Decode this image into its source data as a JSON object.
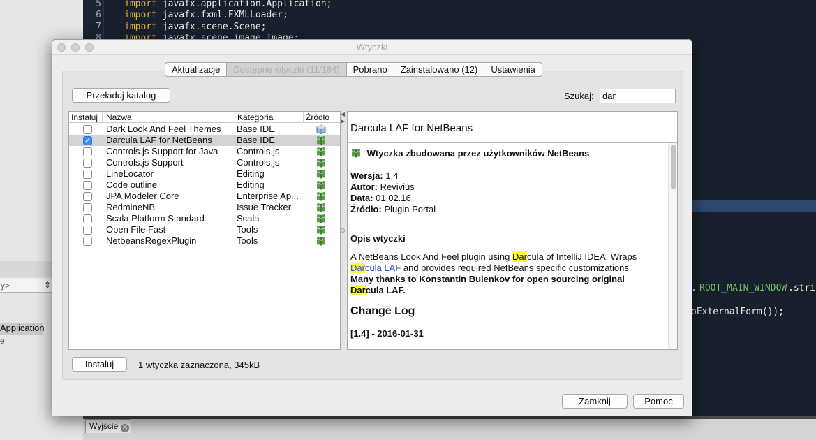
{
  "ide": {
    "code_lines": [
      {
        "num": "5",
        "keyword": "import",
        "text": " javafx.application.Application;"
      },
      {
        "num": "6",
        "keyword": "import",
        "text": " javafx.fxml.FXMLLoader;"
      },
      {
        "num": "7",
        "keyword": "import",
        "text": " javafx.scene.Scene;"
      },
      {
        "num": "8",
        "keyword": "import",
        "text": " javafx.scene.image.Image;"
      }
    ],
    "fragment_1_green": "ROOT_MAIN_WINDOW",
    "fragment_1_prefix": ".",
    "fragment_1_suffix": ".stri",
    "fragment_2": "oExternalForm());",
    "left_combo": "y>",
    "left_selected": "Application",
    "left_sub": "e",
    "output_tab": "Wyjście"
  },
  "dialog": {
    "title": "Wtyczki",
    "tabs": [
      {
        "label": "Aktualizacje"
      },
      {
        "label": "Dostępne wtyczki (11/184)"
      },
      {
        "label": "Pobrano"
      },
      {
        "label": "Zainstalowano (12)"
      },
      {
        "label": "Ustawienia"
      }
    ],
    "reload_button": "Przeładuj katalog",
    "search_label": "Szukaj:",
    "search_value": "dar",
    "table": {
      "headers": [
        "Instaluj",
        "Nazwa",
        "Kategoria",
        "Źródło"
      ],
      "rows": [
        {
          "checked": false,
          "name": "Dark Look And Feel Themes",
          "category": "Base IDE",
          "source_icon": "cube-icon"
        },
        {
          "checked": true,
          "name": "Darcula LAF for NetBeans",
          "category": "Base IDE",
          "source_icon": "community-icon"
        },
        {
          "checked": false,
          "name": "Controls.js Support for Java",
          "category": "Controls.js",
          "source_icon": "community-icon"
        },
        {
          "checked": false,
          "name": "Controls.js Support",
          "category": "Controls.js",
          "source_icon": "community-icon"
        },
        {
          "checked": false,
          "name": "LineLocator",
          "category": "Editing",
          "source_icon": "community-icon"
        },
        {
          "checked": false,
          "name": "Code outline",
          "category": "Editing",
          "source_icon": "community-icon"
        },
        {
          "checked": false,
          "name": "JPA Modeler Core",
          "category": "Enterprise Ap...",
          "source_icon": "community-icon"
        },
        {
          "checked": false,
          "name": "RedmineNB",
          "category": "Issue Tracker",
          "source_icon": "community-icon"
        },
        {
          "checked": false,
          "name": "Scala Platform Standard",
          "category": "Scala",
          "source_icon": "community-icon"
        },
        {
          "checked": false,
          "name": "Open File Fast",
          "category": "Tools",
          "source_icon": "community-icon"
        },
        {
          "checked": false,
          "name": "NetbeansRegexPlugin",
          "category": "Tools",
          "source_icon": "community-icon"
        }
      ]
    },
    "details": {
      "title": "Darcula LAF for NetBeans",
      "community_text": "Wtyczka zbudowana przez użytkowników NetBeans",
      "version_label": "Wersja:",
      "version": "1.4",
      "author_label": "Autor:",
      "author": "Revivius",
      "date_label": "Data:",
      "date": "01.02.16",
      "source_label": "Źródło:",
      "source": "Plugin Portal",
      "desc_heading": "Opis wtyczki",
      "desc_p1_a": "A NetBeans Look And Feel plugin using ",
      "highlight": "Dar",
      "desc_p1_b": "cula of IntelliJ IDEA. Wraps",
      "link_rest": "cula LAF",
      "desc_p1_c": " and provides required NetBeans specific customizations.",
      "desc_bold_a": "Many thanks to Konstantin Bulenkov for open sourcing original",
      "desc_bold_b": "cula LAF.",
      "changelog_heading": "Change Log",
      "changelog_entry": "[1.4] - 2016-01-31"
    },
    "install_button": "Instaluj",
    "status": "1 wtyczka zaznaczona, 345kB",
    "close_button": "Zamknij",
    "help_button": "Pomoc"
  }
}
